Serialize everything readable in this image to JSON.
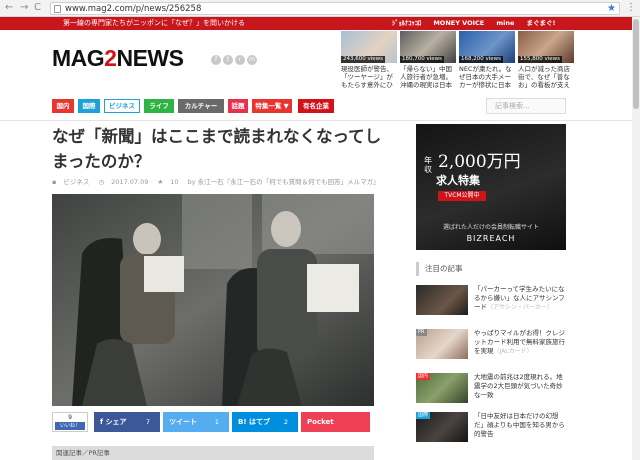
{
  "browser": {
    "url": "www.mag2.com/p/news/256258",
    "back": "←",
    "forward": "→",
    "reload": "C",
    "bookmark": "★",
    "menu": "⋮"
  },
  "topbar": {
    "slogan": "第一線の専門家たちがニッポンに「なぜ？」を問いかける",
    "partners": [
      "ｼﾞｮﾙﾅｺｯｺﾛ",
      "MONEY VOICE",
      "mine",
      "まぐまぐ!"
    ]
  },
  "site": {
    "logo_main": "MAG",
    "logo_accent": "2",
    "logo_rest": "NEWS"
  },
  "top_news": [
    {
      "views": "243,600 views",
      "caption": "現役医師が警告、「ツーヤージ」がもたらす意外にひ"
    },
    {
      "views": "180,700 views",
      "caption": "「帰らない」中国人旅行者が急増。沖縄の現実は日本の"
    },
    {
      "views": "168,200 views",
      "caption": "NECが粛たれ。なぜ日本の大手メーカーが惨状に日本再生"
    },
    {
      "views": "155,800 views",
      "caption": "人口が減った商店街で、なぜ「普なお」の看板が支えられた"
    }
  ],
  "categories": [
    "国内",
    "国際",
    "ビジネス",
    "ライフ",
    "カルチャー",
    "話題",
    "特集一覧 ▼",
    "有名企業"
  ],
  "search": {
    "placeholder": "記事検索..."
  },
  "article": {
    "title": "なぜ「新聞」はここまで読まれなくなってしまったのか？",
    "category": "ビジネス",
    "date": "2017.07.09",
    "stars": "10",
    "author": "by 永江一石『永江一石の「何でも質問＆何でも回答」メルマガ』"
  },
  "share": {
    "like_count": "9",
    "like_label": "いいね！",
    "facebook": "f シェア",
    "facebook_count": "7",
    "twitter": "ツイート",
    "twitter_count": "1",
    "hatena": "B! はてブ",
    "hatena_count": "2",
    "pocket": "Pocket"
  },
  "related_label": "関連記事／PR記事",
  "ad": {
    "prefix": "年収",
    "big": "2,000万円",
    "sub": "求人特集",
    "badge": "TVCM公開中",
    "tagline": "選ばれた人だけの会員制転職サイト",
    "brand": "BIZREACH"
  },
  "sidebar": {
    "heading": "注目の記事",
    "items": [
      {
        "label": "",
        "text": "「パーカーって学生みたいになるから嫌い」な人にアサシンフード",
        "source": "（アサシン・パーカー）"
      },
      {
        "label": "PR",
        "text": "やっぱりマイルがお得！クレジットカード利用で無料家族旅行を実現",
        "source": "（JALカード）"
      },
      {
        "label": "国内",
        "text": "大地震の前兆は2度現れる。地震学の2大巨頭が気づいた奇妙な一致",
        "source": ""
      },
      {
        "label": "国際",
        "text": "「日中友好は日本だけの幻想だ」顔よりも中国を知る男から的警告",
        "source": ""
      }
    ]
  },
  "colors": {
    "brand_red": "#c8161d",
    "cat_domestic": "#e8352f",
    "cat_intl": "#1ea1d9",
    "cat_business": "#1ea1d9",
    "cat_life": "#2fb344",
    "cat_culture": "#6a6a6a",
    "cat_topic": "#e7304b",
    "cat_special": "#e8352f",
    "cat_company": "#d0121b",
    "facebook": "#3b5998",
    "twitter": "#55acee",
    "hatena": "#008fde",
    "pocket": "#ef4056"
  }
}
